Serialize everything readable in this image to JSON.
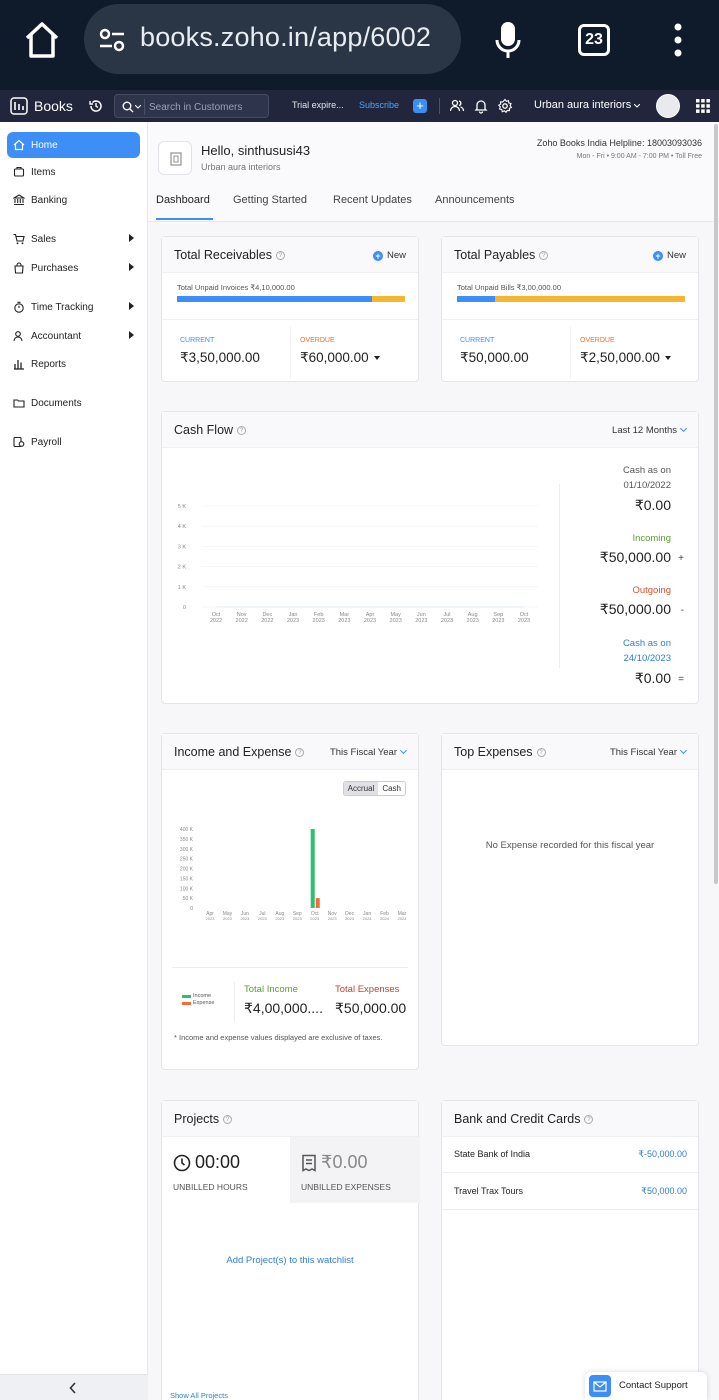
{
  "browser": {
    "url": "books.zoho.in/app/6002",
    "tab_count": "23"
  },
  "header": {
    "brand": "Books",
    "search_placeholder": "Search in Customers",
    "trial": "Trial expire...",
    "subscribe": "Subscribe",
    "org_name": "Urban aura interiors"
  },
  "sidebar": {
    "items": [
      {
        "label": "Home"
      },
      {
        "label": "Items"
      },
      {
        "label": "Banking"
      },
      {
        "label": "Sales"
      },
      {
        "label": "Purchases"
      },
      {
        "label": "Time Tracking"
      },
      {
        "label": "Accountant"
      },
      {
        "label": "Reports"
      },
      {
        "label": "Documents"
      },
      {
        "label": "Payroll"
      }
    ]
  },
  "welcome": {
    "greeting": "Hello, sinthususi43",
    "org": "Urban aura interiors",
    "helpline": "Zoho Books India Helpline: 18003093036",
    "hours": "Mon - Fri • 9:00 AM - 7:00 PM • Toll Free"
  },
  "tabs": [
    "Dashboard",
    "Getting Started",
    "Recent Updates",
    "Announcements"
  ],
  "receivables": {
    "title": "Total Receivables",
    "new_label": "New",
    "unpaid_label": "Total Unpaid Invoices ₹4,10,000.00",
    "current_fraction": 0.854,
    "current_label": "CURRENT",
    "current_value": "₹3,50,000.00",
    "overdue_label": "OVERDUE",
    "overdue_value": "₹60,000.00"
  },
  "payables": {
    "title": "Total Payables",
    "new_label": "New",
    "unpaid_label": "Total Unpaid Bills ₹3,00,000.00",
    "current_fraction": 0.167,
    "current_label": "CURRENT",
    "current_value": "₹50,000.00",
    "overdue_label": "OVERDUE",
    "overdue_value": "₹2,50,000.00"
  },
  "cashflow": {
    "title": "Cash Flow",
    "period": "Last 12 Months",
    "cash_start_label_1": "Cash as on",
    "cash_start_label_2": "01/10/2022",
    "cash_start_value": "₹0.00",
    "incoming_label": "Incoming",
    "incoming_value": "₹50,000.00",
    "incoming_sign": "+",
    "outgoing_label": "Outgoing",
    "outgoing_value": "₹50,000.00",
    "outgoing_sign": "-",
    "cash_end_label_1": "Cash as on",
    "cash_end_label_2": "24/10/2023",
    "cash_end_value": "₹0.00",
    "end_sign": "="
  },
  "income_expense": {
    "title": "Income and Expense",
    "period": "This Fiscal Year",
    "toggle": [
      "Accrual",
      "Cash"
    ],
    "legend_income": "Income",
    "legend_expense": "Expense",
    "total_income_label": "Total Income",
    "total_income_value": "₹4,00,000....",
    "total_expense_label": "Total Expenses",
    "total_expense_value": "₹50,000.00",
    "footnote": "* Income and expense values displayed are exclusive of taxes."
  },
  "top_expenses": {
    "title": "Top Expenses",
    "period": "This Fiscal Year",
    "empty": "No Expense recorded for this fiscal year"
  },
  "projects": {
    "title": "Projects",
    "hours_value": "00:00",
    "hours_label": "UNBILLED HOURS",
    "expenses_value": "₹0.00",
    "expenses_label": "UNBILLED EXPENSES",
    "watchlist": "Add Project(s) to this watchlist",
    "show_all": "Show All Projects"
  },
  "bank": {
    "title": "Bank and Credit Cards",
    "rows": [
      {
        "name": "State Bank of India",
        "amount": "₹-50,000.00"
      },
      {
        "name": "Travel Trax Tours",
        "amount": "₹50,000.00"
      }
    ]
  },
  "support": {
    "label": "Contact Support"
  },
  "colors": {
    "accent": "#3e8ef7",
    "overdue": "#f5b731",
    "income": "#2fbf71",
    "expense": "#f26b38",
    "header": "#21263c"
  },
  "chart_data": [
    {
      "type": "line",
      "title": "Cash Flow",
      "categories": [
        "Oct 2022",
        "Nov 2022",
        "Dec 2022",
        "Jan 2023",
        "Feb 2023",
        "Mar 2023",
        "Apr 2023",
        "May 2023",
        "Jun 2023",
        "Jul 2023",
        "Aug 2023",
        "Sep 2023",
        "Oct 2023"
      ],
      "x_ticks": [
        [
          "Oct",
          "2022"
        ],
        [
          "Nov",
          "2022"
        ],
        [
          "Dec",
          "2022"
        ],
        [
          "Jan",
          "2023"
        ],
        [
          "Feb",
          "2023"
        ],
        [
          "Mar",
          "2023"
        ],
        [
          "Apr",
          "2023"
        ],
        [
          "May",
          "2023"
        ],
        [
          "Jun",
          "2023"
        ],
        [
          "Jul",
          "2023"
        ],
        [
          "Aug",
          "2023"
        ],
        [
          "Sep",
          "2023"
        ],
        [
          "Oct",
          "2023"
        ]
      ],
      "y_ticks": [
        "0",
        "1 K",
        "2 K",
        "3 K",
        "4 K",
        "5 K"
      ],
      "ylim": [
        0,
        5000
      ],
      "values": [
        0,
        0,
        0,
        0,
        0,
        0,
        0,
        0,
        0,
        0,
        0,
        0,
        0
      ]
    },
    {
      "type": "bar",
      "title": "Income and Expense",
      "categories": [
        "Apr 2023",
        "May 2023",
        "Jun 2023",
        "Jul 2023",
        "Aug 2023",
        "Sep 2023",
        "Oct 2023",
        "Nov 2023",
        "Dec 2023",
        "Jan 2024",
        "Feb 2024",
        "Mar 2024"
      ],
      "x_ticks": [
        [
          "Apr",
          "2023"
        ],
        [
          "May",
          "2023"
        ],
        [
          "Jun",
          "2023"
        ],
        [
          "Jul",
          "2023"
        ],
        [
          "Aug",
          "2023"
        ],
        [
          "Sep",
          "2023"
        ],
        [
          "Oct",
          "2023"
        ],
        [
          "Nov",
          "2023"
        ],
        [
          "Dec",
          "2023"
        ],
        [
          "Jan",
          "2024"
        ],
        [
          "Feb",
          "2024"
        ],
        [
          "Mar",
          "2024"
        ]
      ],
      "y_ticks": [
        "0",
        "50 K",
        "100 K",
        "150 K",
        "200 K",
        "250 K",
        "300 K",
        "350 K",
        "400 K"
      ],
      "ylim": [
        0,
        400000
      ],
      "series": [
        {
          "name": "Income",
          "values": [
            0,
            0,
            0,
            0,
            0,
            0,
            400000,
            0,
            0,
            0,
            0,
            0
          ]
        },
        {
          "name": "Expense",
          "values": [
            0,
            0,
            0,
            0,
            0,
            0,
            50000,
            0,
            0,
            0,
            0,
            0
          ]
        }
      ]
    }
  ]
}
